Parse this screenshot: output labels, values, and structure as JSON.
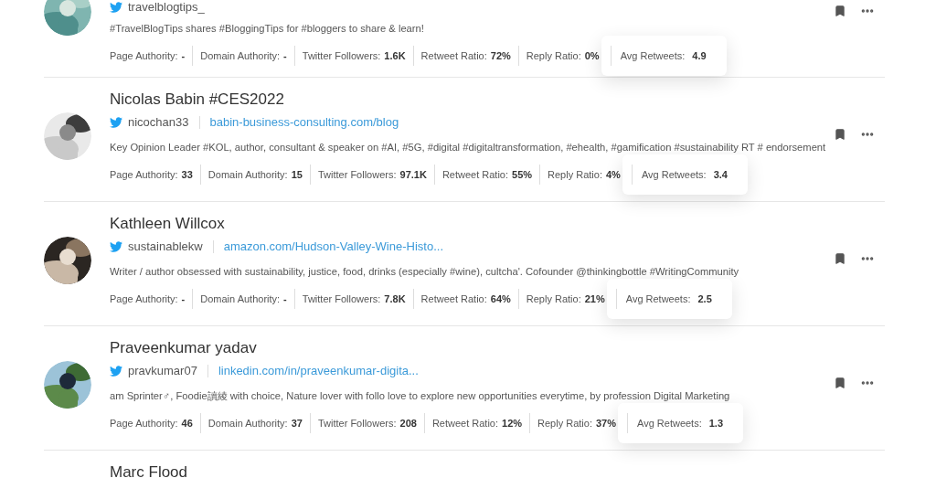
{
  "influencers": [
    {
      "handle": "travelblogtips_",
      "bio": "#TravelBlogTips shares #BloggingTips for #bloggers to share & learn!",
      "stats": [
        {
          "label": "Page Authority:",
          "value": "-"
        },
        {
          "label": "Domain Authority:",
          "value": "-"
        },
        {
          "label": "Twitter Followers:",
          "value": "1.6K"
        },
        {
          "label": "Retweet Ratio:",
          "value": "72%"
        },
        {
          "label": "Reply Ratio:",
          "value": "0%"
        }
      ],
      "highlight": {
        "label": "Avg Retweets:",
        "value": "4.9"
      }
    },
    {
      "name": "Nicolas Babin #CES2022",
      "handle": "nicochan33",
      "website": "babin-business-consulting.com/blog",
      "bio": "Key Opinion Leader #KOL, author, consultant & speaker on #AI, #5G, #digital #digitaltransformation, #ehealth, #gamification #sustainability RT # endorsement",
      "stats": [
        {
          "label": "Page Authority:",
          "value": "33"
        },
        {
          "label": "Domain Authority:",
          "value": "15"
        },
        {
          "label": "Twitter Followers:",
          "value": "97.1K"
        },
        {
          "label": "Retweet Ratio:",
          "value": "55%"
        },
        {
          "label": "Reply Ratio:",
          "value": "4%"
        }
      ],
      "highlight": {
        "label": "Avg Retweets:",
        "value": "3.4"
      }
    },
    {
      "name": "Kathleen Willcox",
      "handle": "sustainablekw",
      "website": "amazon.com/Hudson-Valley-Wine-Histo...",
      "bio": "Writer / author obsessed with sustainability, justice, food, drinks (especially #wine), cultcha'. Cofounder @thinkingbottle #WritingCommunity",
      "stats": [
        {
          "label": "Page Authority:",
          "value": "-"
        },
        {
          "label": "Domain Authority:",
          "value": "-"
        },
        {
          "label": "Twitter Followers:",
          "value": "7.8K"
        },
        {
          "label": "Retweet Ratio:",
          "value": "64%"
        },
        {
          "label": "Reply Ratio:",
          "value": "21%"
        }
      ],
      "highlight": {
        "label": "Avg Retweets:",
        "value": "2.5"
      }
    },
    {
      "name": "Praveenkumar yadav",
      "handle": "pravkumar07",
      "website": "linkedin.com/in/praveenkumar-digita...",
      "bio": "am Sprinter♂, Foodie讀綾 with choice, Nature lover with follo love to explore new opportunities everytime, by profession Digital Marketing",
      "stats": [
        {
          "label": "Page Authority:",
          "value": "46"
        },
        {
          "label": "Domain Authority:",
          "value": "37"
        },
        {
          "label": "Twitter Followers:",
          "value": "208"
        },
        {
          "label": "Retweet Ratio:",
          "value": "12%"
        },
        {
          "label": "Reply Ratio:",
          "value": "37%"
        }
      ],
      "highlight": {
        "label": "Avg Retweets:",
        "value": "1.3"
      }
    },
    {
      "name": "Marc Flood"
    }
  ]
}
